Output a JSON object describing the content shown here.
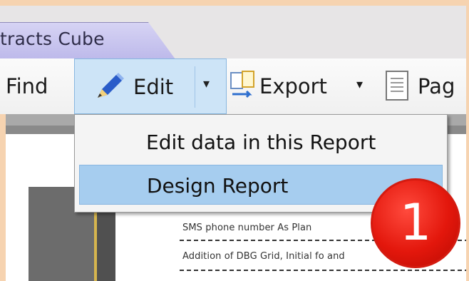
{
  "tab": {
    "label": "tracts Cube"
  },
  "toolbar": {
    "find_label": "Find",
    "edit_label": "Edit",
    "export_label": "Export",
    "page_label": "Pag"
  },
  "menu": {
    "items": [
      {
        "label": "Edit data in this Report",
        "highlighted": false
      },
      {
        "label": "Design Report",
        "highlighted": true
      }
    ]
  },
  "document": {
    "rows": [
      "SMS phone number As Plan",
      "Addition of DBG Grid, Initial fo      and"
    ]
  },
  "badge": {
    "number": "1",
    "color": "#e3170c"
  },
  "colors": {
    "background": "#f6d3b0",
    "highlight": "#a6cdef",
    "edit_button": "#cde4f7"
  },
  "icons": [
    "pencil-icon",
    "export-icon",
    "page-icon",
    "dropdown-caret-icon"
  ]
}
